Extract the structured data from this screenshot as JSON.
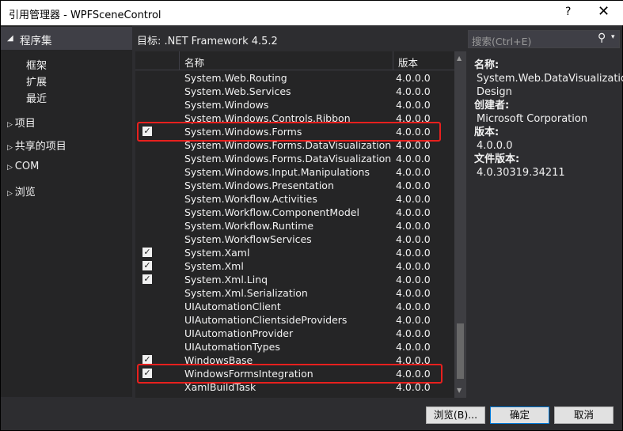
{
  "window": {
    "title": "引用管理器 - WPFSceneControl",
    "help": "?",
    "close": "✕"
  },
  "sidebar": {
    "header": "程序集",
    "items": [
      "框架",
      "扩展",
      "最近"
    ],
    "groups": [
      "项目",
      "共享的项目",
      "COM",
      "浏览"
    ]
  },
  "target": "目标: .NET Framework 4.5.2",
  "search": {
    "placeholder": "搜索(Ctrl+E)"
  },
  "list": {
    "columns": [
      "名称",
      "版本"
    ],
    "rows": [
      {
        "name": "System.Web.Routing",
        "version": "4.0.0.0",
        "checked": false
      },
      {
        "name": "System.Web.Services",
        "version": "4.0.0.0",
        "checked": false
      },
      {
        "name": "System.Windows",
        "version": "4.0.0.0",
        "checked": false
      },
      {
        "name": "System.Windows.Controls.Ribbon",
        "version": "4.0.0.0",
        "checked": false
      },
      {
        "name": "System.Windows.Forms",
        "version": "4.0.0.0",
        "checked": true,
        "highlight": true
      },
      {
        "name": "System.Windows.Forms.DataVisualization",
        "version": "4.0.0.0",
        "checked": false
      },
      {
        "name": "System.Windows.Forms.DataVisualization....",
        "version": "4.0.0.0",
        "checked": false
      },
      {
        "name": "System.Windows.Input.Manipulations",
        "version": "4.0.0.0",
        "checked": false
      },
      {
        "name": "System.Windows.Presentation",
        "version": "4.0.0.0",
        "checked": false
      },
      {
        "name": "System.Workflow.Activities",
        "version": "4.0.0.0",
        "checked": false
      },
      {
        "name": "System.Workflow.ComponentModel",
        "version": "4.0.0.0",
        "checked": false
      },
      {
        "name": "System.Workflow.Runtime",
        "version": "4.0.0.0",
        "checked": false
      },
      {
        "name": "System.WorkflowServices",
        "version": "4.0.0.0",
        "checked": false
      },
      {
        "name": "System.Xaml",
        "version": "4.0.0.0",
        "checked": true
      },
      {
        "name": "System.Xml",
        "version": "4.0.0.0",
        "checked": true
      },
      {
        "name": "System.Xml.Linq",
        "version": "4.0.0.0",
        "checked": true
      },
      {
        "name": "System.Xml.Serialization",
        "version": "4.0.0.0",
        "checked": false
      },
      {
        "name": "UIAutomationClient",
        "version": "4.0.0.0",
        "checked": false
      },
      {
        "name": "UIAutomationClientsideProviders",
        "version": "4.0.0.0",
        "checked": false
      },
      {
        "name": "UIAutomationProvider",
        "version": "4.0.0.0",
        "checked": false
      },
      {
        "name": "UIAutomationTypes",
        "version": "4.0.0.0",
        "checked": false
      },
      {
        "name": "WindowsBase",
        "version": "4.0.0.0",
        "checked": true
      },
      {
        "name": "WindowsFormsIntegration",
        "version": "4.0.0.0",
        "checked": true,
        "highlight": true
      },
      {
        "name": "XamlBuildTask",
        "version": "4.0.0.0",
        "checked": false
      }
    ]
  },
  "details": [
    {
      "label": "名称:",
      "value": "System.Web.DataVisualization.\nDesign"
    },
    {
      "label": "创建者:",
      "value": "Microsoft Corporation"
    },
    {
      "label": "版本:",
      "value": "4.0.0.0"
    },
    {
      "label": "文件版本:",
      "value": "4.0.30319.34211"
    }
  ],
  "buttons": {
    "browse": "浏览(B)...",
    "ok": "确定",
    "cancel": "取消"
  },
  "colors": {
    "highlight": "#e8201e",
    "background": "#2d2d30",
    "panel": "#252526"
  }
}
